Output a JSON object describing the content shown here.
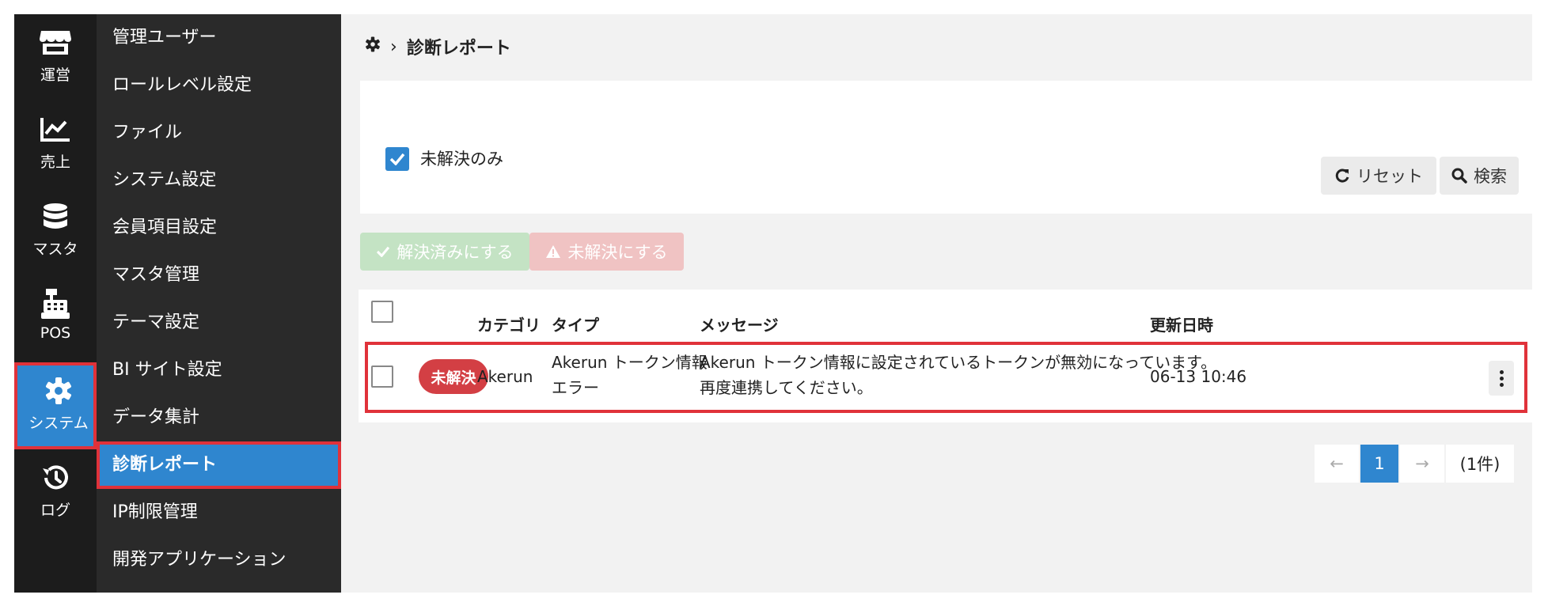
{
  "rail": {
    "items": [
      {
        "label": "運営",
        "icon": "store-icon"
      },
      {
        "label": "売上",
        "icon": "chart-line-icon"
      },
      {
        "label": "マスタ",
        "icon": "database-icon"
      },
      {
        "label": "POS",
        "icon": "cash-register-icon"
      },
      {
        "label": "システム",
        "icon": "gear-icon",
        "active": true
      },
      {
        "label": "ログ",
        "icon": "history-icon"
      }
    ]
  },
  "menu": {
    "items": [
      {
        "label": "管理ユーザー"
      },
      {
        "label": "ロールレベル設定"
      },
      {
        "label": "ファイル"
      },
      {
        "label": "システム設定"
      },
      {
        "label": "会員項目設定"
      },
      {
        "label": "マスタ管理"
      },
      {
        "label": "テーマ設定"
      },
      {
        "label": "BI サイト設定"
      },
      {
        "label": "データ集計"
      },
      {
        "label": "診断レポート",
        "active": true
      },
      {
        "label": "IP制限管理"
      },
      {
        "label": "開発アプリケーション"
      }
    ]
  },
  "breadcrumb": {
    "separator": "›",
    "title": "診断レポート"
  },
  "filter": {
    "unresolved_only_label": "未解決のみ",
    "unresolved_only_checked": true,
    "reset_label": "リセット",
    "search_label": "検索"
  },
  "actions": {
    "resolve_label": "解決済みにする",
    "unresolve_label": "未解決にする"
  },
  "table": {
    "headers": {
      "category": "カテゴリ",
      "type": "タイプ",
      "message": "メッセージ",
      "updated": "更新日時"
    },
    "rows": [
      {
        "status": "未解決",
        "category": "Akerun",
        "type_line1": "Akerun トークン情報",
        "type_line2": "エラー",
        "message_line1": "Akerun トークン情報に設定されているトークンが無効になっています。",
        "message_line2": "再度連携してください。",
        "updated": "06-13 10:46"
      }
    ]
  },
  "pagination": {
    "prev": "←",
    "current": "1",
    "next": "→",
    "count": "(1件)"
  },
  "colors": {
    "accent": "#2f86cf",
    "danger": "#d33f44",
    "highlight_border": "#e0323a"
  }
}
